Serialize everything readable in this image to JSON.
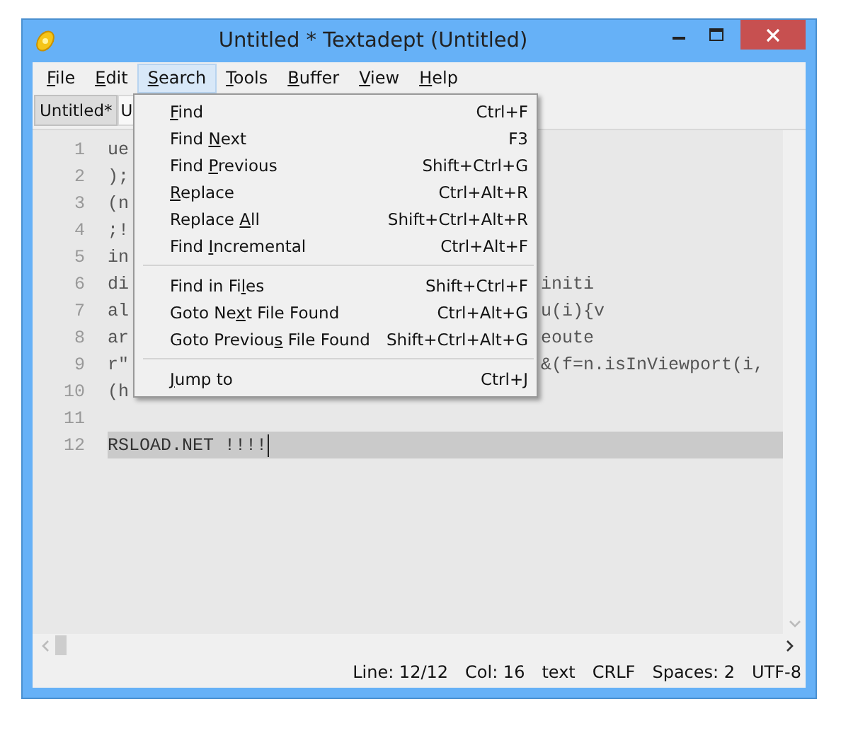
{
  "window": {
    "title": "Untitled * Textadept (Untitled)"
  },
  "menubar": [
    {
      "key": "F",
      "post": "ile",
      "selected": false
    },
    {
      "key": "E",
      "post": "dit",
      "selected": false
    },
    {
      "key": "S",
      "post": "earch",
      "selected": true
    },
    {
      "key": "T",
      "post": "ools",
      "selected": false
    },
    {
      "key": "B",
      "post": "uffer",
      "selected": false
    },
    {
      "key": "V",
      "post": "iew",
      "selected": false
    },
    {
      "key": "H",
      "post": "elp",
      "selected": false
    }
  ],
  "tabs": [
    {
      "label": "Untitled*",
      "selected": true
    },
    {
      "label": "U",
      "selected": false
    }
  ],
  "editor": {
    "lines": [
      {
        "number": "1",
        "text": "ue",
        "current": false
      },
      {
        "number": "2",
        "text": ");",
        "current": false
      },
      {
        "number": "3",
        "text": "(n",
        "current": false
      },
      {
        "number": "4",
        "text": ";!",
        "current": false
      },
      {
        "number": "5",
        "text": "in",
        "current": false
      },
      {
        "number": "6",
        "text": "di",
        "text_right": "initi",
        "current": false
      },
      {
        "number": "7",
        "text": "al",
        "text_right": "u(i){v",
        "current": false
      },
      {
        "number": "8",
        "text": "ar",
        "text_right": "eoute",
        "current": false
      },
      {
        "number": "9",
        "text": "r\"",
        "text_right": "&(f=n.isInViewport(i,",
        "current": false
      },
      {
        "number": "10",
        "text": "(h",
        "current": false
      },
      {
        "number": "11",
        "current": false
      },
      {
        "number": "12",
        "text": "RSLOAD.NET !!!!",
        "current": true
      }
    ]
  },
  "search_menu": [
    {
      "kind": "item",
      "key": "F",
      "post": "ind",
      "shortcut": "Ctrl+F"
    },
    {
      "kind": "item",
      "pre": "Find ",
      "key": "N",
      "post": "ext",
      "shortcut": "F3"
    },
    {
      "kind": "item",
      "pre": "Find ",
      "key": "P",
      "post": "revious",
      "shortcut": "Shift+Ctrl+G"
    },
    {
      "kind": "item",
      "key": "R",
      "post": "eplace",
      "shortcut": "Ctrl+Alt+R"
    },
    {
      "kind": "item",
      "pre": "Replace ",
      "key": "A",
      "post": "ll",
      "shortcut": "Shift+Ctrl+Alt+R"
    },
    {
      "kind": "item",
      "pre": "Find ",
      "key": "I",
      "post": "ncremental",
      "shortcut": "Ctrl+Alt+F"
    },
    {
      "kind": "separator"
    },
    {
      "kind": "item",
      "pre": "Find in Fi",
      "key": "l",
      "post": "es",
      "shortcut": "Shift+Ctrl+F"
    },
    {
      "kind": "item",
      "pre": "Goto Ne",
      "key": "x",
      "post": "t File Found",
      "shortcut": "Ctrl+Alt+G"
    },
    {
      "kind": "item",
      "pre": "Goto Previou",
      "key": "s",
      "post": " File Found",
      "shortcut": "Shift+Ctrl+Alt+G"
    },
    {
      "kind": "separator"
    },
    {
      "kind": "item",
      "key": "J",
      "post": "ump to",
      "shortcut": "Ctrl+J"
    }
  ],
  "status_bar": [
    "Line: 12/12",
    "Col: 16",
    "text",
    "CRLF",
    "Spaces: 2",
    "UTF-8"
  ]
}
